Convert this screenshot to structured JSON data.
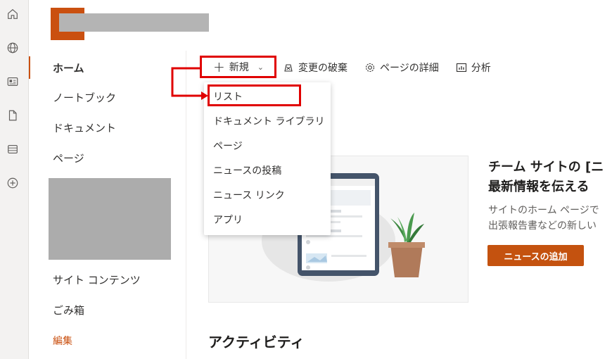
{
  "rail": {
    "icons": [
      "home-icon",
      "globe-icon",
      "news-icon",
      "file-icon",
      "list-icon",
      "add-icon"
    ]
  },
  "colors": {
    "brand": "#ca5010",
    "highlight": "#e00000"
  },
  "nav": {
    "items": [
      {
        "label": "ホーム",
        "active": true
      },
      {
        "label": "ノートブック"
      },
      {
        "label": "ドキュメント"
      },
      {
        "label": "ページ"
      }
    ],
    "site_contents": "サイト コンテンツ",
    "recycle_bin": "ごみ箱",
    "edit": "編集"
  },
  "cmdbar": {
    "new_label": "新規",
    "discard_label": "変更の破棄",
    "page_details_label": "ページの詳細",
    "analytics_label": "分析"
  },
  "new_menu": {
    "items": [
      "リスト",
      "ドキュメント ライブラリ",
      "ページ",
      "ニュースの投稿",
      "ニュース リンク",
      "アプリ"
    ]
  },
  "news": {
    "title_line1": "チーム サイトの [ニ",
    "title_line2": "最新情報を伝える",
    "desc_line1": "サイトのホーム ページで",
    "desc_line2": "出張報告書などの新しい",
    "add_button": "ニュースの追加"
  },
  "activity_heading": "アクティビティ"
}
